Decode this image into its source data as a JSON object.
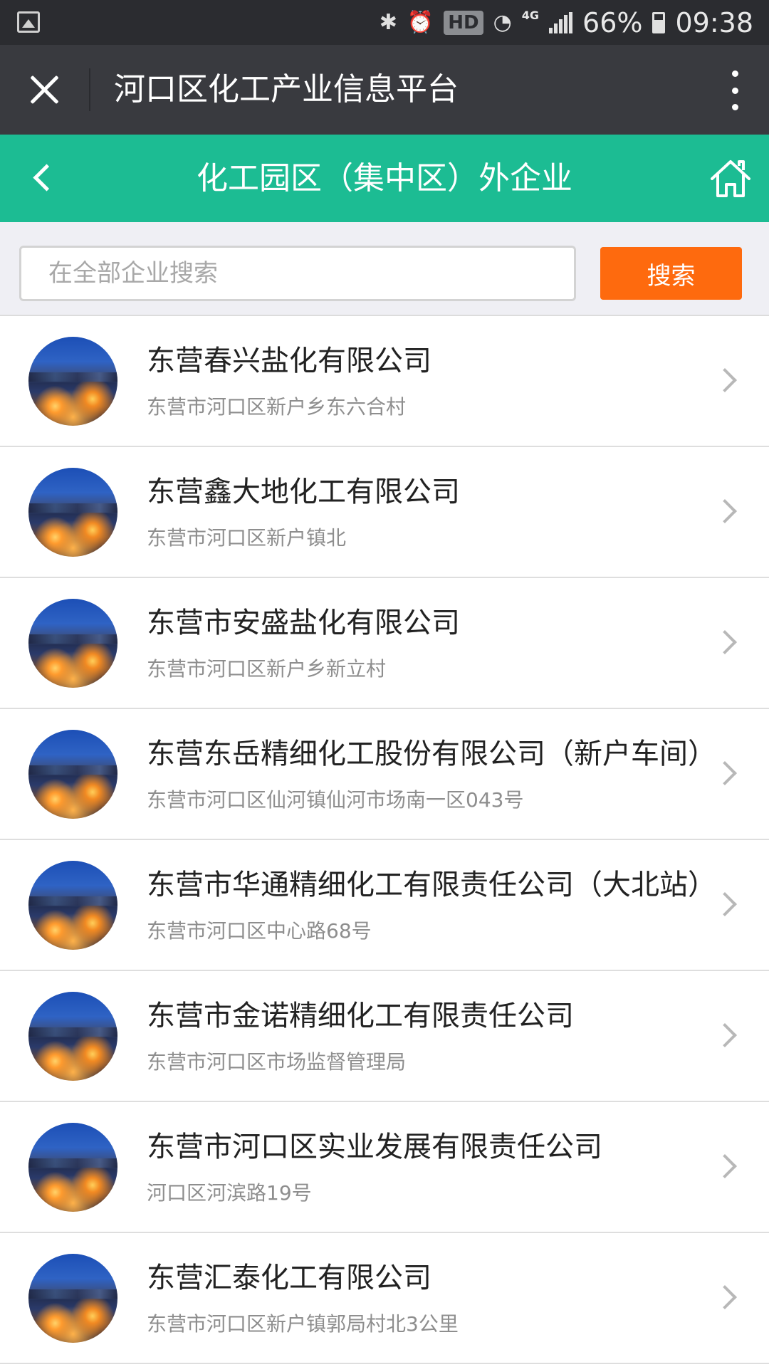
{
  "status_bar": {
    "hd": "HD",
    "network": "4G",
    "battery": "66%",
    "time": "09:38"
  },
  "wechat_bar": {
    "title": "河口区化工产业信息平台"
  },
  "header": {
    "title": "化工园区（集中区）外企业"
  },
  "search": {
    "placeholder": "在全部企业搜索",
    "value": "",
    "button_label": "搜索"
  },
  "companies": [
    {
      "name": "东营春兴盐化有限公司",
      "address": "东营市河口区新户乡东六合村"
    },
    {
      "name": "东营鑫大地化工有限公司",
      "address": "东营市河口区新户镇北"
    },
    {
      "name": "东营市安盛盐化有限公司",
      "address": "东营市河口区新户乡新立村"
    },
    {
      "name": "东营东岳精细化工股份有限公司（新户车间）",
      "address": "东营市河口区仙河镇仙河市场南一区043号"
    },
    {
      "name": "东营市华通精细化工有限责任公司（大北站）",
      "address": "东营市河口区中心路68号"
    },
    {
      "name": "东营市金诺精细化工有限责任公司",
      "address": "东营市河口区市场监督管理局"
    },
    {
      "name": "东营市河口区实业发展有限责任公司",
      "address": "河口区河滨路19号"
    },
    {
      "name": "东营汇泰化工有限公司",
      "address": "东营市河口区新户镇郭局村北3公里"
    }
  ],
  "colors": {
    "status_bar": "#2b2c30",
    "wechat_bar": "#393a3f",
    "header_green": "#1cbc93",
    "search_button": "#fe6a0e",
    "search_area_bg": "#efeff4"
  },
  "icons": {
    "close": "close-icon",
    "more": "more-vertical-icon",
    "back": "chevron-left-icon",
    "home": "home-icon",
    "row": "chevron-right-icon"
  }
}
